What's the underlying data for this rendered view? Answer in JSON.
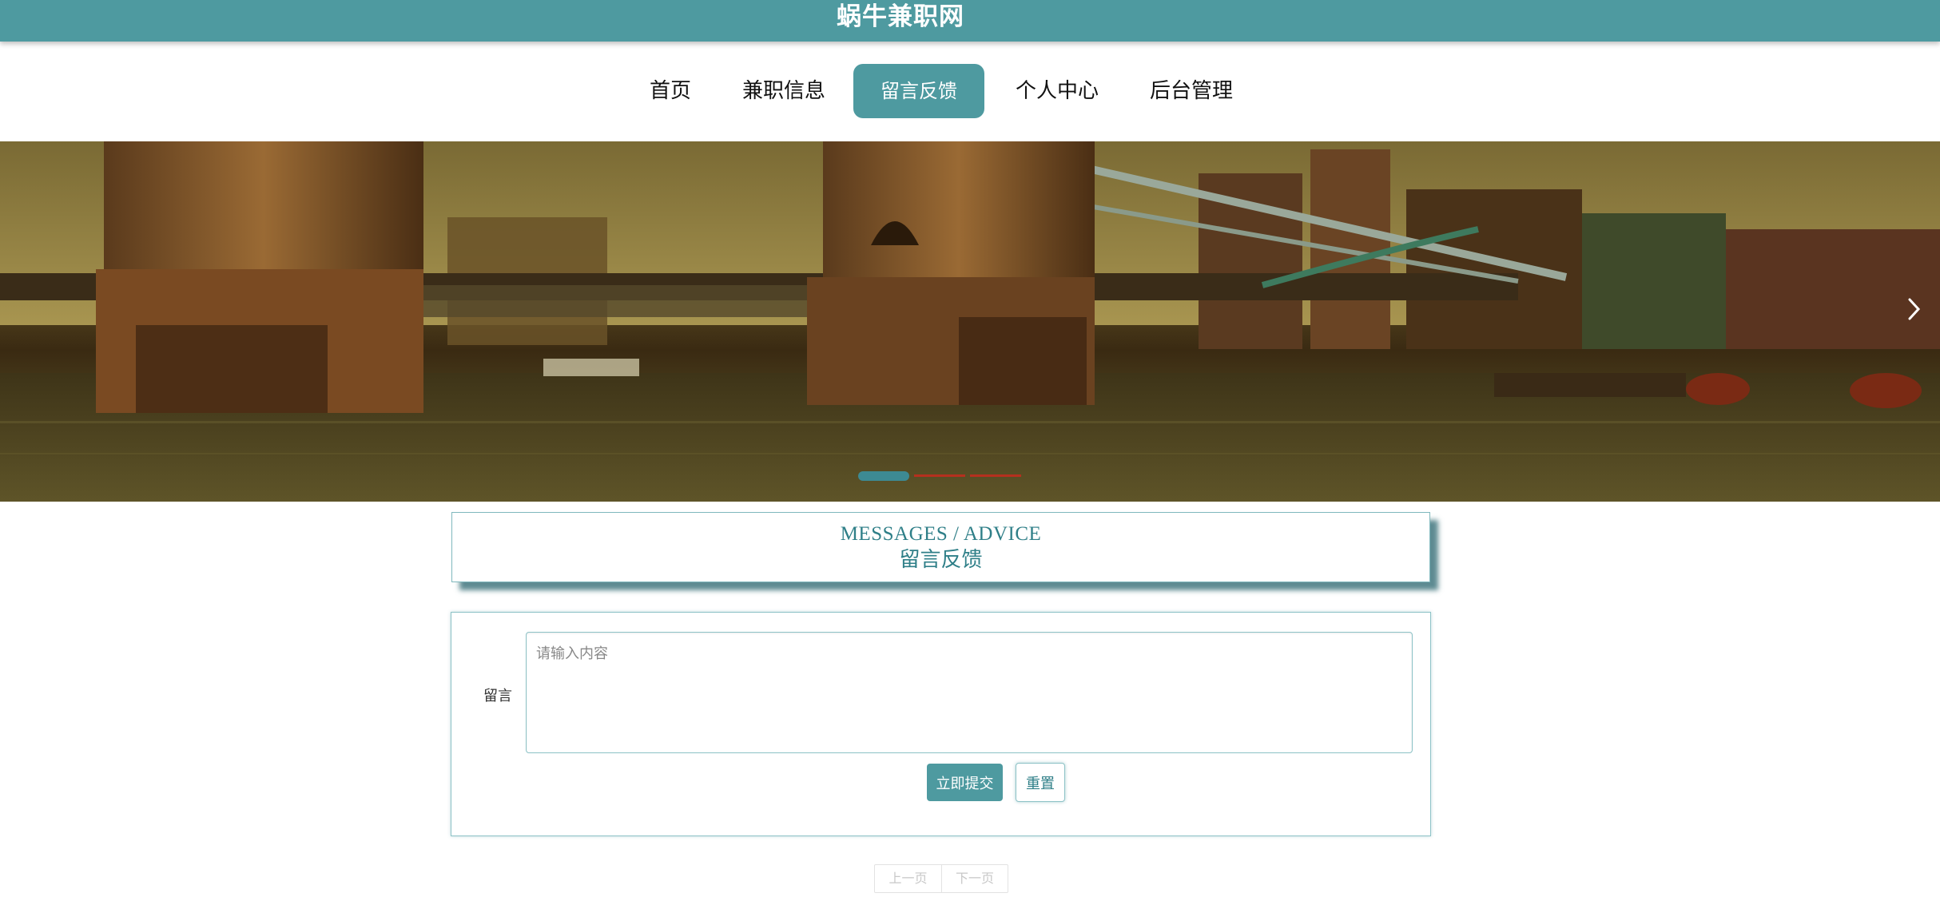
{
  "header": {
    "site_title": "蜗牛兼职网",
    "brand_color": "#4e9aa0"
  },
  "nav": {
    "items": [
      {
        "label": "首页"
      },
      {
        "label": "兼职信息"
      },
      {
        "label": "留言反馈",
        "active": true
      },
      {
        "label": "个人中心"
      },
      {
        "label": "后台管理"
      }
    ]
  },
  "banner": {
    "image_description": "sepia-toned photo of Tower Bridge over the river",
    "next_icon": "chevron-right-icon",
    "indicators": 3,
    "active_indicator": 1
  },
  "section": {
    "title_en": "MESSAGES / ADVICE",
    "title_cn": "留言反馈"
  },
  "form": {
    "label": "留言",
    "placeholder": "请输入内容",
    "value": "",
    "submit_label": "立即提交",
    "reset_label": "重置"
  },
  "pagination": {
    "prev_label": "上一页",
    "next_label": "下一页"
  }
}
